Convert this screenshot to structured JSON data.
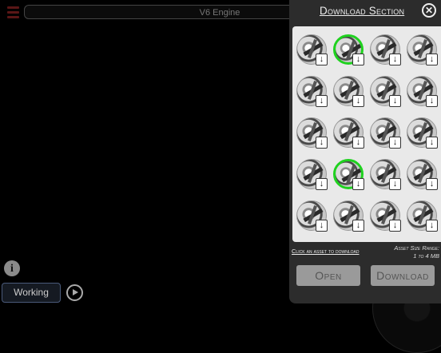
{
  "header": {
    "title": "V6 Engine"
  },
  "controls": {
    "info_glyph": "i",
    "working_label": "Working",
    "play_icon": "play-icon"
  },
  "panel": {
    "title": "Download Section",
    "close_glyph": "✕",
    "hint": "Click an asset to download",
    "size_label_line1": "Asset Size Range:",
    "size_label_line2": "1 to 4 MB",
    "open_label": "Open",
    "download_label": "Download",
    "selected_color": "#1fd21f",
    "assets": [
      {
        "selected": false
      },
      {
        "selected": true
      },
      {
        "selected": false
      },
      {
        "selected": false
      },
      {
        "selected": false
      },
      {
        "selected": false
      },
      {
        "selected": false
      },
      {
        "selected": false
      },
      {
        "selected": false
      },
      {
        "selected": false
      },
      {
        "selected": false
      },
      {
        "selected": false
      },
      {
        "selected": false
      },
      {
        "selected": true
      },
      {
        "selected": false
      },
      {
        "selected": false
      },
      {
        "selected": false
      },
      {
        "selected": false
      },
      {
        "selected": false
      },
      {
        "selected": false
      }
    ]
  }
}
